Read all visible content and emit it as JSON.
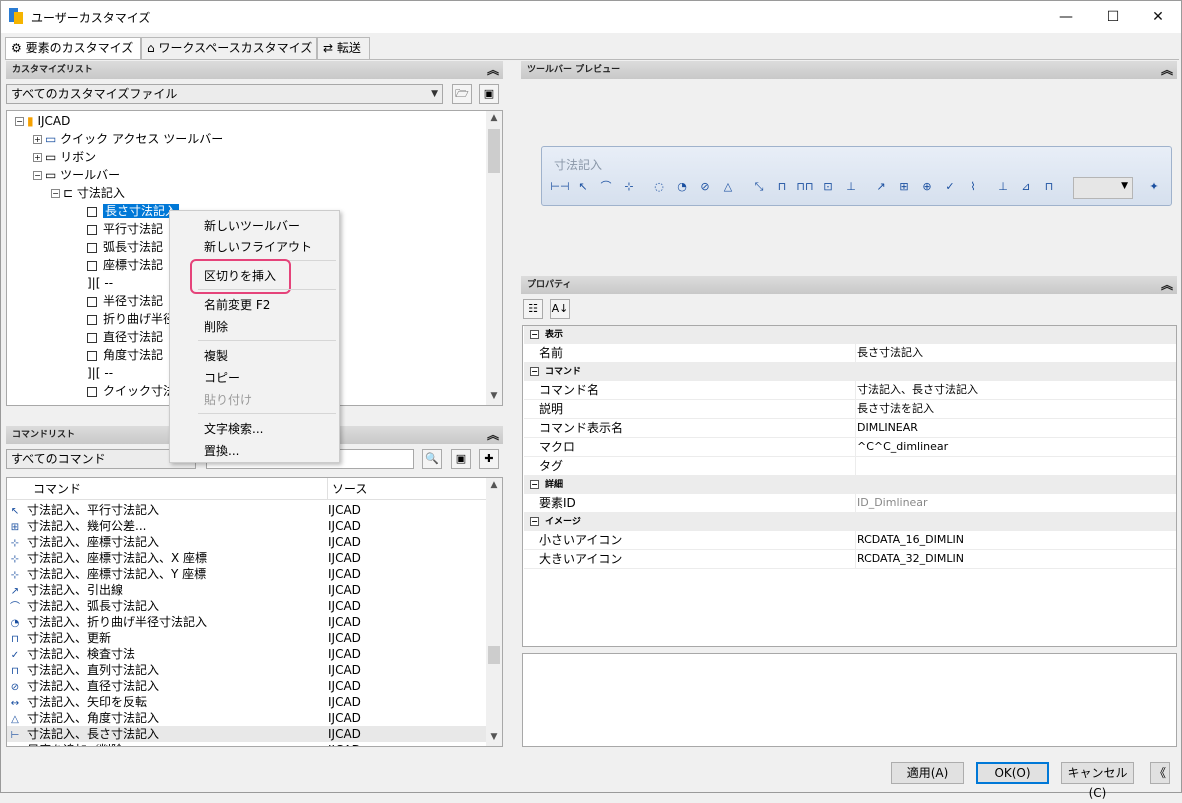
{
  "window": {
    "title": "ユーザーカスタマイズ",
    "minimize": "—",
    "maximize": "☐",
    "close": "✕"
  },
  "tabs": [
    {
      "label": "要素のカスタマイズ",
      "icon": "gear-icon"
    },
    {
      "label": "ワークスペースカスタマイズ",
      "icon": "home-icon"
    },
    {
      "label": "転送",
      "icon": "transfer-icon"
    }
  ],
  "customize_list": {
    "header": "カスタマイズリスト",
    "file_combo": "すべてのカスタマイズファイル",
    "tree": [
      {
        "label": "IJCAD",
        "expander": "−"
      },
      {
        "label": "クイック アクセス ツールバー",
        "expander": "+"
      },
      {
        "label": "リボン",
        "expander": "+"
      },
      {
        "label": "ツールバー",
        "expander": "−"
      },
      {
        "label": "寸法記入",
        "expander": "−"
      },
      {
        "label": "長さ寸法記入",
        "selected": true
      },
      {
        "label": "平行寸法記"
      },
      {
        "label": "弧長寸法記"
      },
      {
        "label": "座標寸法記"
      },
      {
        "label": "--"
      },
      {
        "label": "半径寸法記"
      },
      {
        "label": "折り曲げ半径"
      },
      {
        "label": "直径寸法記"
      },
      {
        "label": "角度寸法記"
      },
      {
        "label": "--"
      },
      {
        "label": "クイック寸法"
      }
    ]
  },
  "context_menu": {
    "items": [
      {
        "label": "新しいツールバー"
      },
      {
        "label": "新しいフライアウト"
      },
      {
        "label": "区切りを挿入",
        "highlighted": true
      },
      {
        "label": "名前変更 F2"
      },
      {
        "label": "削除"
      },
      {
        "label": "複製"
      },
      {
        "label": "コピー"
      },
      {
        "label": "貼り付け",
        "disabled": true
      },
      {
        "label": "文字検索..."
      },
      {
        "label": "置換..."
      }
    ]
  },
  "command_list": {
    "header": "コマンドリスト",
    "filter_combo": "すべてのコマンド",
    "search_value": "",
    "columns": [
      "コマンド",
      "ソース"
    ],
    "rows": [
      {
        "command": "寸法記入、平行寸法記入",
        "source": "IJCAD"
      },
      {
        "command": "寸法記入、幾何公差...",
        "source": "IJCAD"
      },
      {
        "command": "寸法記入、座標寸法記入",
        "source": "IJCAD"
      },
      {
        "command": "寸法記入、座標寸法記入、X 座標",
        "source": "IJCAD"
      },
      {
        "command": "寸法記入、座標寸法記入、Y 座標",
        "source": "IJCAD"
      },
      {
        "command": "寸法記入、引出線",
        "source": "IJCAD"
      },
      {
        "command": "寸法記入、弧長寸法記入",
        "source": "IJCAD"
      },
      {
        "command": "寸法記入、折り曲げ半径寸法記入",
        "source": "IJCAD"
      },
      {
        "command": "寸法記入、更新",
        "source": "IJCAD"
      },
      {
        "command": "寸法記入、検査寸法",
        "source": "IJCAD"
      },
      {
        "command": "寸法記入、直列寸法記入",
        "source": "IJCAD"
      },
      {
        "command": "寸法記入、直径寸法記入",
        "source": "IJCAD"
      },
      {
        "command": "寸法記入、矢印を反転",
        "source": "IJCAD"
      },
      {
        "command": "寸法記入、角度寸法記入",
        "source": "IJCAD"
      },
      {
        "command": "寸法記入、長さ寸法記入",
        "source": "IJCAD"
      },
      {
        "command": "尺度を追加／削除",
        "source": "IJCAD"
      }
    ]
  },
  "toolbar_preview": {
    "header": "ツールバー プレビュー",
    "toolbar_title": "寸法記入"
  },
  "properties": {
    "header": "プロパティ",
    "groups": [
      {
        "name": "表示",
        "rows": [
          {
            "key": "名前",
            "value": "長さ寸法記入"
          }
        ]
      },
      {
        "name": "コマンド",
        "rows": [
          {
            "key": "コマンド名",
            "value": "寸法記入、長さ寸法記入"
          },
          {
            "key": "説明",
            "value": "長さ寸法を記入"
          },
          {
            "key": "コマンド表示名",
            "value": "DIMLINEAR"
          },
          {
            "key": "マクロ",
            "value": "^C^C_dimlinear"
          },
          {
            "key": "タグ",
            "value": ""
          }
        ]
      },
      {
        "name": "詳細",
        "rows": [
          {
            "key": "要素ID",
            "value": "ID_Dimlinear",
            "gray": true
          }
        ]
      },
      {
        "name": "イメージ",
        "rows": [
          {
            "key": "小さいアイコン",
            "value": "RCDATA_16_DIMLIN"
          },
          {
            "key": "大きいアイコン",
            "value": "RCDATA_32_DIMLIN"
          }
        ]
      }
    ]
  },
  "buttons": {
    "apply": "適用(A)",
    "ok": "OK(O)",
    "cancel": "キャンセル(C)",
    "collapse": "《"
  }
}
